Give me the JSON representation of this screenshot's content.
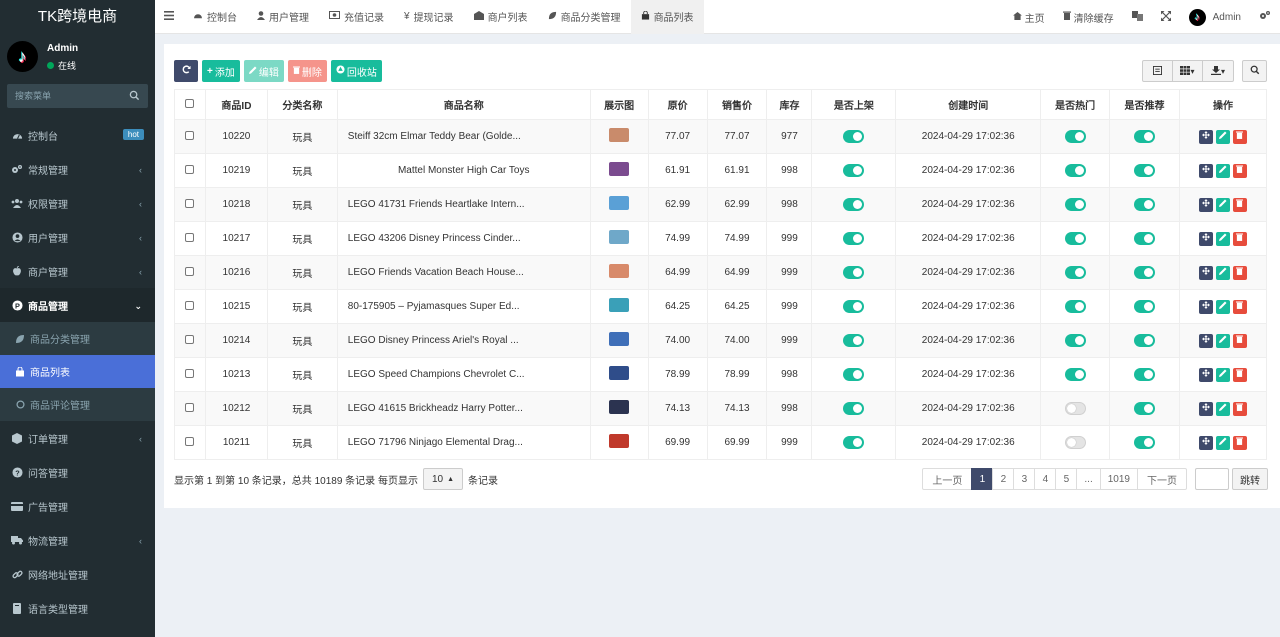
{
  "app": {
    "logo": "TK跨境电商"
  },
  "user": {
    "name": "Admin",
    "status": "在线"
  },
  "search": {
    "placeholder": "搜索菜单"
  },
  "sidebar": {
    "hot_badge": "hot",
    "items": [
      {
        "label": "控制台",
        "icon": "dashboard-icon"
      },
      {
        "label": "常规管理",
        "icon": "cogs-icon"
      },
      {
        "label": "权限管理",
        "icon": "group-icon"
      },
      {
        "label": "用户管理",
        "icon": "user-circle-icon"
      },
      {
        "label": "商户管理",
        "icon": "apple-icon"
      },
      {
        "label": "商品管理",
        "icon": "product-hunt-icon"
      },
      {
        "label": "订单管理",
        "icon": "cube-icon"
      },
      {
        "label": "问答管理",
        "icon": "question-circle-icon"
      },
      {
        "label": "广告管理",
        "icon": "credit-card-icon"
      },
      {
        "label": "物流管理",
        "icon": "truck-icon"
      },
      {
        "label": "网络地址管理",
        "icon": "link-icon"
      },
      {
        "label": "语言类型管理",
        "icon": "book-icon"
      }
    ],
    "sub_items": [
      {
        "label": "商品分类管理",
        "icon": "leaf-icon"
      },
      {
        "label": "商品列表",
        "icon": "shopping-bag-icon"
      },
      {
        "label": "商品评论管理",
        "icon": "circle-o-icon"
      }
    ]
  },
  "topbar": {
    "tabs": [
      {
        "label": "控制台"
      },
      {
        "label": "用户管理"
      },
      {
        "label": "充值记录"
      },
      {
        "label": "提现记录"
      },
      {
        "label": "商户列表"
      },
      {
        "label": "商品分类管理"
      },
      {
        "label": "商品列表"
      }
    ],
    "home": "主页",
    "clear_cache": "清除缓存",
    "admin": "Admin"
  },
  "toolbar": {
    "add": "添加",
    "edit": "编辑",
    "delete": "删除",
    "recycle": "回收站"
  },
  "table": {
    "headers": [
      "商品ID",
      "分类名称",
      "商品名称",
      "展示图",
      "原价",
      "销售价",
      "库存",
      "是否上架",
      "创建时间",
      "是否热门",
      "是否推荐",
      "操作"
    ],
    "rows": [
      {
        "id": "10220",
        "cat": "玩具",
        "name": "Steiff 32cm Elmar Teddy Bear (Golde...",
        "price": "77.07",
        "sale": "77.07",
        "stock": "977",
        "time": "2024-04-29 17:02:36",
        "on_sale": true,
        "hot": true,
        "rec": true,
        "thumb": "#c98b6b"
      },
      {
        "id": "10219",
        "cat": "玩具",
        "name": "Mattel Monster High Car Toys",
        "price": "61.91",
        "sale": "61.91",
        "stock": "998",
        "time": "2024-04-29 17:02:36",
        "on_sale": true,
        "hot": true,
        "rec": true,
        "thumb": "#7b4b8f"
      },
      {
        "id": "10218",
        "cat": "玩具",
        "name": "LEGO 41731 Friends Heartlake Intern...",
        "price": "62.99",
        "sale": "62.99",
        "stock": "998",
        "time": "2024-04-29 17:02:36",
        "on_sale": true,
        "hot": true,
        "rec": true,
        "thumb": "#5aa0d6"
      },
      {
        "id": "10217",
        "cat": "玩具",
        "name": "LEGO 43206 Disney Princess Cinder...",
        "price": "74.99",
        "sale": "74.99",
        "stock": "999",
        "time": "2024-04-29 17:02:36",
        "on_sale": true,
        "hot": true,
        "rec": true,
        "thumb": "#6fa8c9"
      },
      {
        "id": "10216",
        "cat": "玩具",
        "name": "LEGO Friends Vacation Beach House...",
        "price": "64.99",
        "sale": "64.99",
        "stock": "999",
        "time": "2024-04-29 17:02:36",
        "on_sale": true,
        "hot": true,
        "rec": true,
        "thumb": "#d88a6a"
      },
      {
        "id": "10215",
        "cat": "玩具",
        "name": "80-175905 – Pyjamasques Super Ed...",
        "price": "64.25",
        "sale": "64.25",
        "stock": "999",
        "time": "2024-04-29 17:02:36",
        "on_sale": true,
        "hot": true,
        "rec": true,
        "thumb": "#3aa0b8"
      },
      {
        "id": "10214",
        "cat": "玩具",
        "name": "LEGO Disney Princess Ariel's Royal ...",
        "price": "74.00",
        "sale": "74.00",
        "stock": "999",
        "time": "2024-04-29 17:02:36",
        "on_sale": true,
        "hot": true,
        "rec": true,
        "thumb": "#3f6fb8"
      },
      {
        "id": "10213",
        "cat": "玩具",
        "name": "LEGO Speed Champions Chevrolet C...",
        "price": "78.99",
        "sale": "78.99",
        "stock": "998",
        "time": "2024-04-29 17:02:36",
        "on_sale": true,
        "hot": true,
        "rec": true,
        "thumb": "#2f4d8a"
      },
      {
        "id": "10212",
        "cat": "玩具",
        "name": "LEGO 41615 Brickheadz Harry Potter...",
        "price": "74.13",
        "sale": "74.13",
        "stock": "998",
        "time": "2024-04-29 17:02:36",
        "on_sale": true,
        "hot": false,
        "rec": true,
        "thumb": "#2b3350"
      },
      {
        "id": "10211",
        "cat": "玩具",
        "name": "LEGO 71796 Ninjago Elemental Drag...",
        "price": "69.99",
        "sale": "69.99",
        "stock": "999",
        "time": "2024-04-29 17:02:36",
        "on_sale": true,
        "hot": false,
        "rec": true,
        "thumb": "#c0392b"
      }
    ]
  },
  "footer": {
    "info_prefix": "显示第 1 到第 10 条记录，总共 10189 条记录 每页显示",
    "page_size": "10",
    "info_suffix": "条记录"
  },
  "pager": {
    "prev": "上一页",
    "pages": [
      "1",
      "2",
      "3",
      "4",
      "5",
      "...",
      "1019"
    ],
    "next": "下一页",
    "jump": "跳转"
  },
  "colors": {
    "sidebar_bg": "#222d32",
    "accent": "#18bc9c",
    "active_blue": "#4a6fd8",
    "danger": "#e74c3c"
  }
}
